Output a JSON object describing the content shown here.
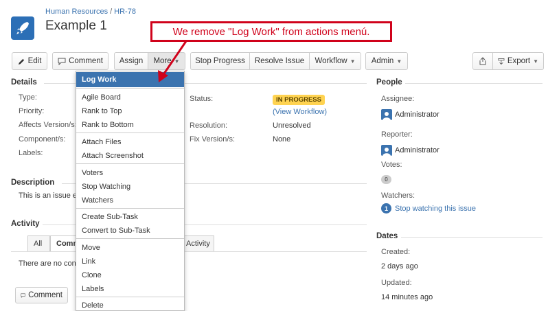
{
  "header": {
    "project_link": "Human Resources",
    "issue_key": "HR-78",
    "title": "Example 1"
  },
  "callout": {
    "text": "We remove \"Log Work\" from actions menú."
  },
  "toolbar": {
    "edit": "Edit",
    "comment": "Comment",
    "assign": "Assign",
    "more": "More",
    "stop_progress": "Stop Progress",
    "resolve_issue": "Resolve Issue",
    "workflow": "Workflow",
    "admin": "Admin",
    "export": "Export"
  },
  "details": {
    "heading": "Details",
    "type_label": "Type:",
    "priority_label": "Priority:",
    "affects_label": "Affects Version/s:",
    "component_label": "Component/s:",
    "labels_label": "Labels:",
    "status_label": "Status:",
    "status_value": "IN PROGRESS",
    "view_workflow": "(View Workflow)",
    "resolution_label": "Resolution:",
    "resolution_value": "Unresolved",
    "fix_label": "Fix Version/s:",
    "fix_value": "None"
  },
  "description": {
    "heading": "Description",
    "text": "This is an issue e"
  },
  "activity": {
    "heading": "Activity",
    "tab_all": "All",
    "tab_comments": "Comm",
    "tab_activity": "Activity",
    "empty_text": "There are no con",
    "comment_button": "Comment"
  },
  "people": {
    "heading": "People",
    "assignee_label": "Assignee:",
    "assignee": "Administrator",
    "reporter_label": "Reporter:",
    "reporter": "Administrator",
    "votes_label": "Votes:",
    "votes_count": "0",
    "watchers_label": "Watchers:",
    "watchers_count": "1",
    "stop_watching": "Stop watching this issue"
  },
  "dates": {
    "heading": "Dates",
    "created_label": "Created:",
    "created_value": "2 days ago",
    "updated_label": "Updated:",
    "updated_value": "14 minutes ago"
  },
  "more_menu": {
    "items": [
      "Log Work",
      "Agile Board",
      "Rank to Top",
      "Rank to Bottom",
      "Attach Files",
      "Attach Screenshot",
      "Voters",
      "Stop Watching",
      "Watchers",
      "Create Sub-Task",
      "Convert to Sub-Task",
      "Move",
      "Link",
      "Clone",
      "Labels",
      "Delete"
    ]
  },
  "colors": {
    "link": "#3b73af",
    "callout": "#d0021b",
    "status_badge": "#ffd351",
    "menu_highlight": "#3b73af"
  }
}
